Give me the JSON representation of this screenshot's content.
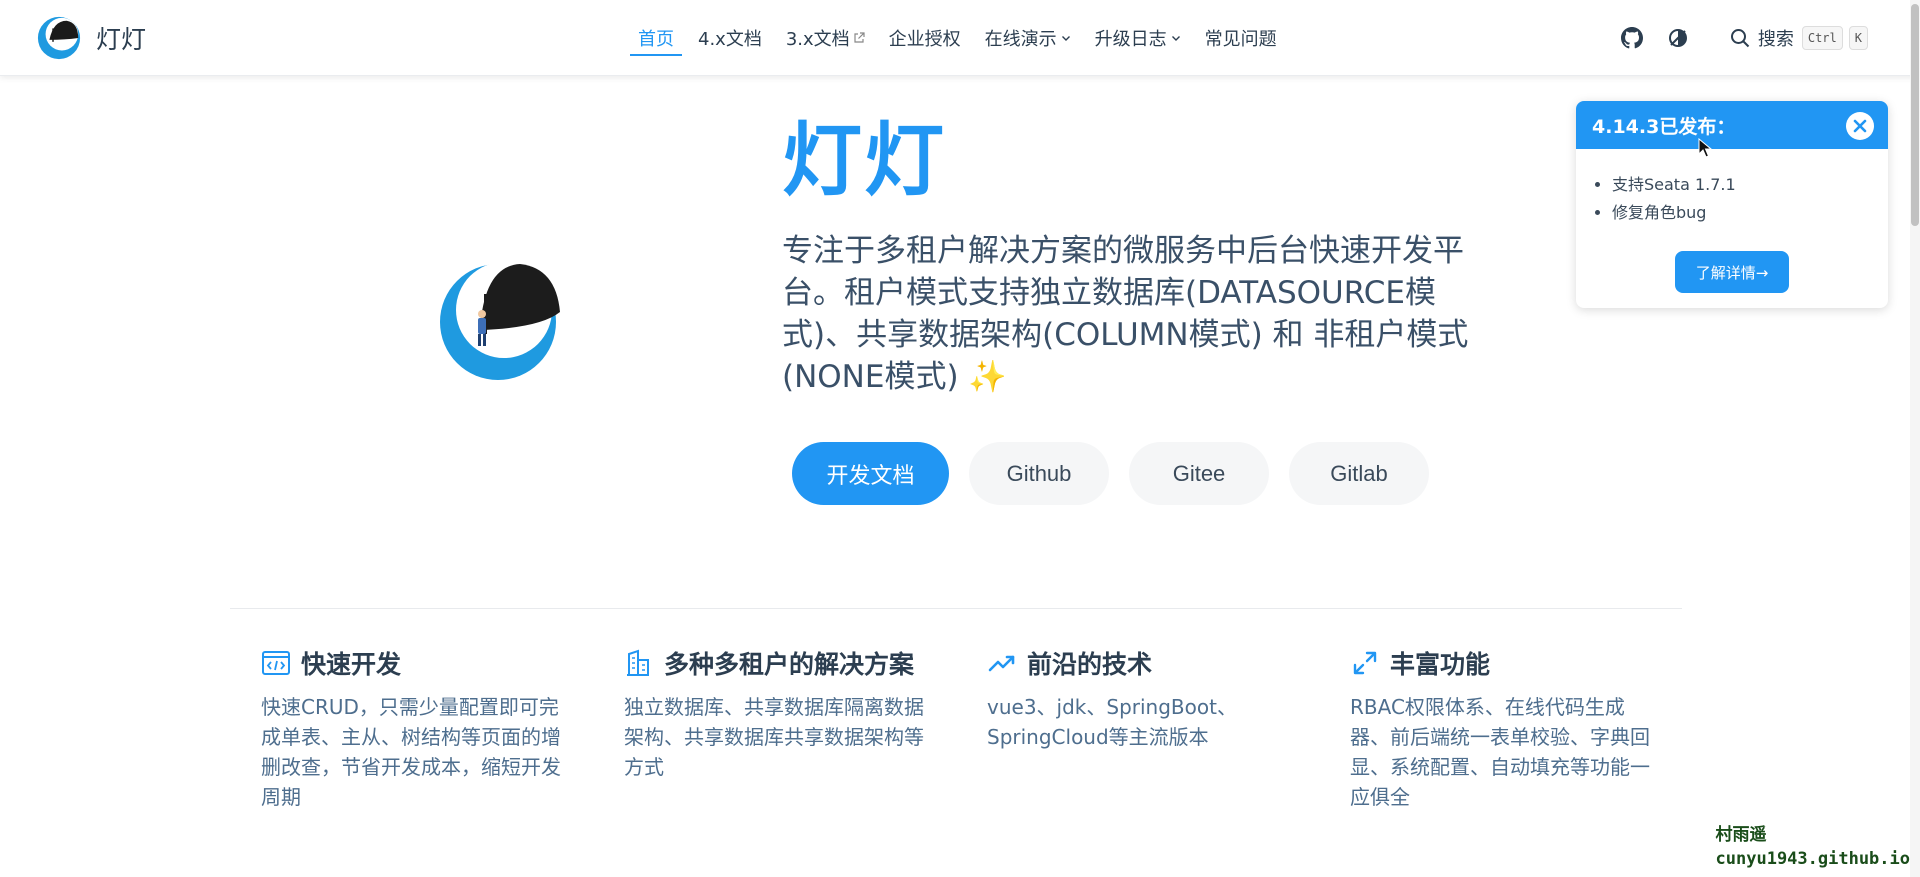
{
  "navbar": {
    "brand_name": "灯灯",
    "links": [
      {
        "label": "首页",
        "active": true
      },
      {
        "label": "4.x文档"
      },
      {
        "label": "3.x文档",
        "external": true
      },
      {
        "label": "企业授权"
      },
      {
        "label": "在线演示",
        "dropdown": true
      },
      {
        "label": "升级日志",
        "dropdown": true
      },
      {
        "label": "常见问题"
      }
    ],
    "search_label": "搜索",
    "search_keys": [
      "Ctrl",
      "K"
    ],
    "icons": [
      "github-icon",
      "theme-toggle-icon",
      "search-icon"
    ]
  },
  "hero": {
    "title": "灯灯",
    "description": "专注于多租户解决方案的微服务中后台快速开发平台。租户模式支持独立数据库(DATASOURCE模式)、共享数据架构(COLUMN模式) 和 非租户模式(NONE模式)",
    "emoji": "✨",
    "actions": [
      {
        "label": "开发文档",
        "primary": true
      },
      {
        "label": "Github"
      },
      {
        "label": "Gitee"
      },
      {
        "label": "Gitlab"
      }
    ]
  },
  "notice": {
    "title": "4.14.3已发布：",
    "items": [
      "支持Seata 1.7.1",
      "修复角色bug"
    ],
    "button": "了解详情→"
  },
  "features": [
    {
      "icon": "code-icon",
      "title": "快速开发",
      "text": "快速CRUD，只需少量配置即可完成单表、主从、树结构等页面的增删改查，节省开发成本，缩短开发周期"
    },
    {
      "icon": "building-icon",
      "title": "多种多租户的解决方案",
      "text": "独立数据库、共享数据库隔离数据架构、共享数据库共享数据架构等方式"
    },
    {
      "icon": "trend-icon",
      "title": "前沿的技术",
      "text": "vue3、jdk、SpringBoot、SpringCloud等主流版本"
    },
    {
      "icon": "expand-icon",
      "title": "丰富功能",
      "text": "RBAC权限体系、在线代码生成器、前后端统一表单校验、字典回显、系统配置、自动填充等功能一应俱全"
    }
  ],
  "watermark": {
    "line1": "村雨遥",
    "line2": "cunyu1943.github.io"
  },
  "colors": {
    "primary": "#2196f3",
    "text": "#2c3e50"
  }
}
